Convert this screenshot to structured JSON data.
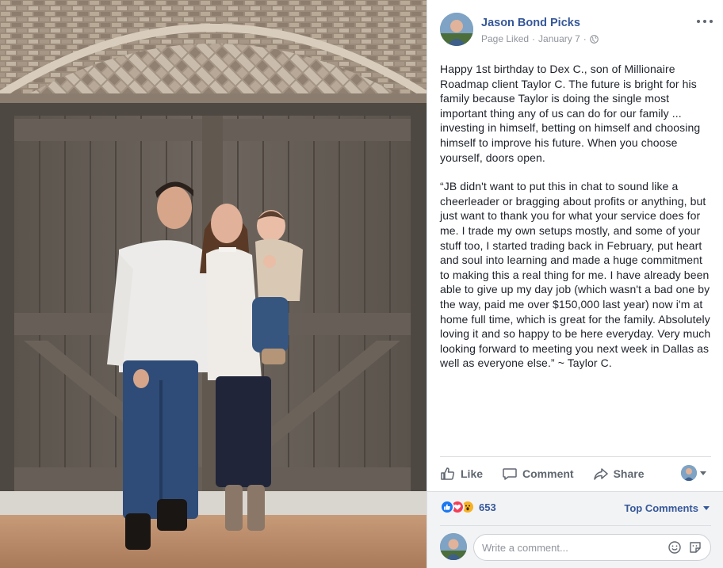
{
  "post": {
    "page_name": "Jason Bond Picks",
    "meta_prefix": "Page Liked",
    "date": "January 7",
    "paragraphs": [
      "Happy 1st birthday to Dex C., son of Millionaire Roadmap client Taylor C. The future is bright for his family because Taylor is doing the single most important thing any of us can do for our family ... investing in himself, betting on himself and choosing himself to improve his future. When you choose yourself, doors open.",
      "“JB didn't want to put this in chat to sound like a cheerleader or bragging about profits or anything, but just want to thank you for what your service does for me. I trade my own setups mostly, and some of your stuff too, I started trading back in February, put heart and soul into learning and made a huge commitment to making this a real thing for me. I have already been able to give up my day job (which wasn't a bad one by the way, paid me over $150,000 last year) now i'm at home full time, which is great for the family. Absolutely loving it and so happy to be here everyday. Very much looking forward to meeting you next week in Dallas as well as everyone else.” ~ Taylor C."
    ]
  },
  "actions": {
    "like_label": "Like",
    "comment_label": "Comment",
    "share_label": "Share"
  },
  "reactions": {
    "count": "653",
    "types": [
      "like-icon",
      "love-icon",
      "wow-icon"
    ]
  },
  "comments": {
    "sort_label": "Top Comments",
    "input_placeholder": "Write a comment..."
  },
  "icons": {
    "globe": "globe-icon",
    "more": "more-options-icon",
    "emoji": "emoji-icon",
    "sticker": "sticker-icon"
  },
  "colors": {
    "link_blue": "#365899",
    "like_blue": "#1877f2",
    "love_red": "#f33e58",
    "wow_yellow": "#f7b125",
    "muted_gray": "#606770"
  }
}
